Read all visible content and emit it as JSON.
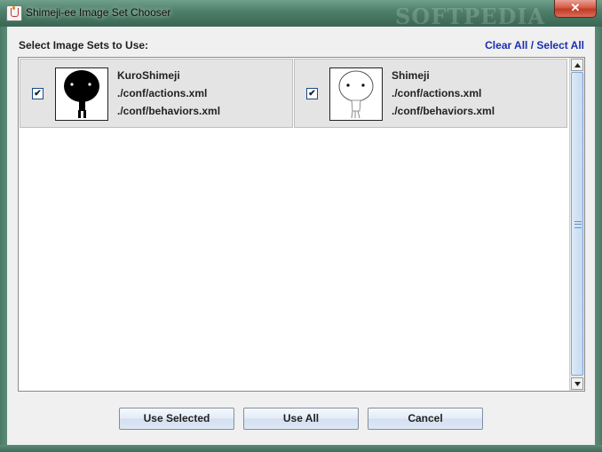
{
  "window": {
    "title": "Shimeji-ee Image Set Chooser",
    "watermark": "SOFTPEDIA",
    "close_glyph": "✕"
  },
  "chooser": {
    "section_label": "Select Image Sets to Use:",
    "clear_all": "Clear All",
    "separator": "/",
    "select_all": "Select All"
  },
  "image_sets": [
    {
      "name": "KuroShimeji",
      "actions": "./conf/actions.xml",
      "behaviors": "./conf/behaviors.xml",
      "checked": true,
      "thumbnail": "black-shimeji-silhouette"
    },
    {
      "name": "Shimeji",
      "actions": "./conf/actions.xml",
      "behaviors": "./conf/behaviors.xml",
      "checked": true,
      "thumbnail": "white-shimeji-figure"
    }
  ],
  "check_glyph": "✔",
  "buttons": {
    "use_selected": "Use Selected",
    "use_all": "Use All",
    "cancel": "Cancel"
  },
  "icons": {
    "app": "java-cup-icon",
    "scroll_up": "arrow-up-icon",
    "scroll_down": "arrow-down-icon",
    "grip": "scroll-grip-icon"
  }
}
